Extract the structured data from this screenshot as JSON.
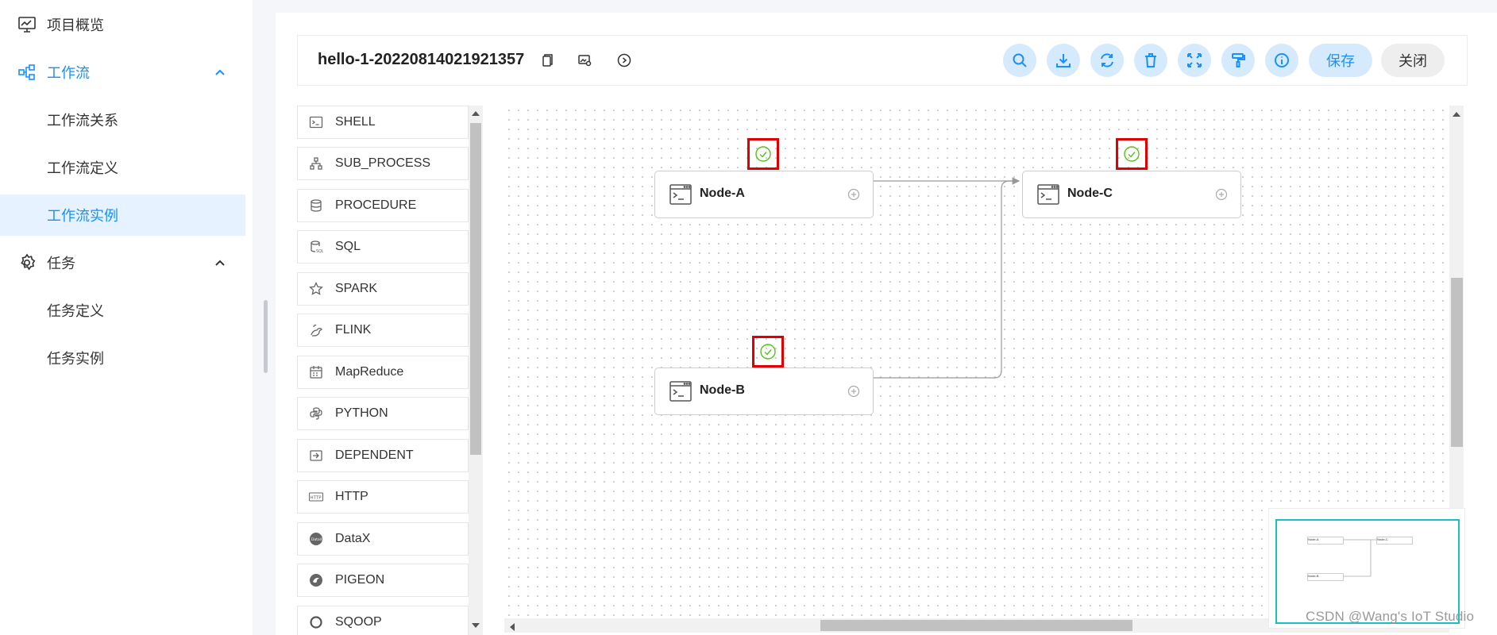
{
  "sidebar": {
    "items": [
      {
        "label": "项目概览",
        "icon": "monitor-chart-icon",
        "type": "item"
      },
      {
        "label": "工作流",
        "icon": "workflow-icon",
        "type": "group",
        "expanded": true
      },
      {
        "label": "工作流关系",
        "type": "sub"
      },
      {
        "label": "工作流定义",
        "type": "sub"
      },
      {
        "label": "工作流实例",
        "type": "sub",
        "active": true
      },
      {
        "label": "任务",
        "icon": "gear-icon",
        "type": "group",
        "expanded": true
      },
      {
        "label": "任务定义",
        "type": "sub"
      },
      {
        "label": "任务实例",
        "type": "sub"
      }
    ]
  },
  "toolbar": {
    "workflow_name": "hello-1-20220814021921357",
    "save_label": "保存",
    "close_label": "关闭",
    "icons": [
      "search-icon",
      "download-icon",
      "refresh-icon",
      "delete-icon",
      "fullscreen-icon",
      "format-brush-icon",
      "info-icon"
    ]
  },
  "task_types": [
    {
      "label": "SHELL",
      "icon": "terminal-icon"
    },
    {
      "label": "SUB_PROCESS",
      "icon": "hierarchy-icon"
    },
    {
      "label": "PROCEDURE",
      "icon": "database-icon"
    },
    {
      "label": "SQL",
      "icon": "sql-icon"
    },
    {
      "label": "SPARK",
      "icon": "star-icon"
    },
    {
      "label": "FLINK",
      "icon": "squirrel-icon"
    },
    {
      "label": "MapReduce",
      "icon": "calendar-grid-icon"
    },
    {
      "label": "PYTHON",
      "icon": "python-icon"
    },
    {
      "label": "DEPENDENT",
      "icon": "dependent-icon"
    },
    {
      "label": "HTTP",
      "icon": "http-icon"
    },
    {
      "label": "DataX",
      "icon": "datax-icon"
    },
    {
      "label": "PIGEON",
      "icon": "pigeon-icon"
    },
    {
      "label": "SQOOP",
      "icon": "sqoop-icon"
    }
  ],
  "nodes": [
    {
      "id": "a",
      "label": "Node-A",
      "status": "success"
    },
    {
      "id": "b",
      "label": "Node-B",
      "status": "success"
    },
    {
      "id": "c",
      "label": "Node-C",
      "status": "success"
    }
  ],
  "minimap": {
    "labels": [
      "Node-A",
      "Node-C",
      "Node-B"
    ]
  },
  "colors": {
    "accent": "#1890ff",
    "success": "#52c41a",
    "highlight_box": "#e00000",
    "minimap_border": "#19c0c0"
  },
  "watermark": "CSDN @Wang's IoT Studio"
}
